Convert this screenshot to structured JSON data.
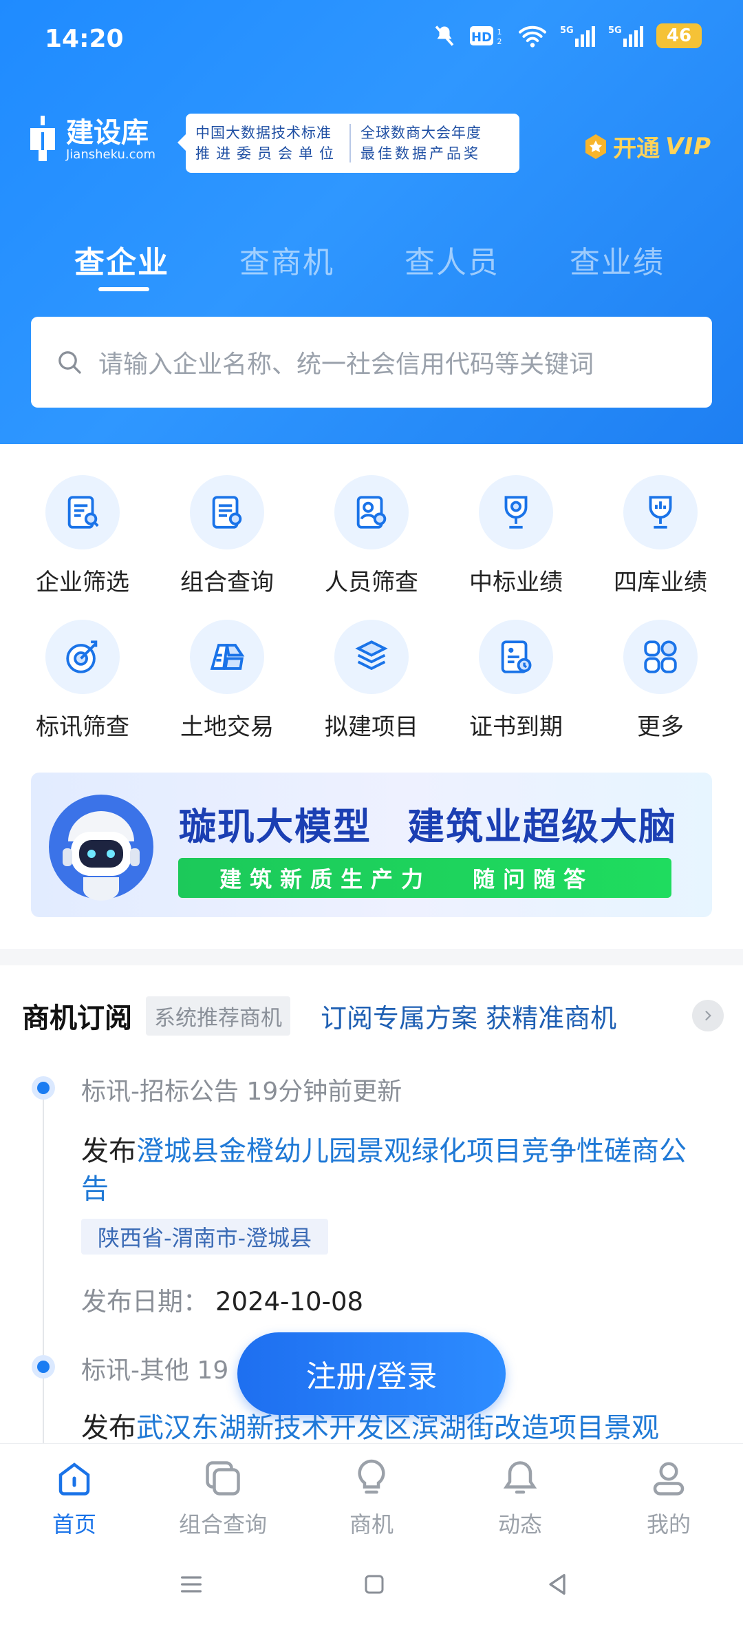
{
  "status": {
    "time": "14:20",
    "battery": "46"
  },
  "brand": {
    "name_cn": "建设库",
    "name_en": "Jiansheku.com"
  },
  "award": {
    "left_line1": "中国大数据技术标准",
    "left_line2": "推进委员会单位",
    "right_line1": "全球数商大会年度",
    "right_line2": "最佳数据产品奖"
  },
  "vip": {
    "label": "开通",
    "tag": "VIP"
  },
  "tabs": [
    "查企业",
    "查商机",
    "查人员",
    "查业绩"
  ],
  "search": {
    "placeholder": "请输入企业名称、统一社会信用代码等关键词"
  },
  "grid": [
    {
      "label": "企业筛选",
      "icon": "company-filter-icon"
    },
    {
      "label": "组合查询",
      "icon": "combined-query-icon"
    },
    {
      "label": "人员筛查",
      "icon": "personnel-check-icon"
    },
    {
      "label": "中标业绩",
      "icon": "bid-win-icon"
    },
    {
      "label": "四库业绩",
      "icon": "four-library-icon"
    },
    {
      "label": "标讯筛查",
      "icon": "bid-info-icon"
    },
    {
      "label": "土地交易",
      "icon": "land-trade-icon"
    },
    {
      "label": "拟建项目",
      "icon": "planned-project-icon"
    },
    {
      "label": "证书到期",
      "icon": "certificate-expiry-icon"
    },
    {
      "label": "更多",
      "icon": "more-icon"
    }
  ],
  "banner": {
    "title1": "璇玑大模型",
    "title2": "建筑业超级大脑",
    "bar_left": "建筑新质生产力",
    "bar_right": "随问随答"
  },
  "section": {
    "title": "商机订阅",
    "tag": "系统推荐商机",
    "subtitle": "订阅专属方案 获精准商机"
  },
  "items": [
    {
      "meta": "标讯-招标公告  19分钟前更新",
      "prefix": "发布",
      "title": "澄城县金橙幼儿园景观绿化项目竞争性磋商公告",
      "region": "陕西省-渭南市-澄城县",
      "date_label": "发布日期：",
      "date": "2024-10-08"
    },
    {
      "meta": "标讯-其他  19",
      "prefix": "发布",
      "title": "武汉东湖新技术开发区滨湖街改造项目景观"
    }
  ],
  "login_button": "注册/登录",
  "nav": [
    {
      "label": "首页",
      "icon": "home-icon",
      "active": true
    },
    {
      "label": "组合查询",
      "icon": "combined-query-nav-icon"
    },
    {
      "label": "商机",
      "icon": "opportunity-icon"
    },
    {
      "label": "动态",
      "icon": "bell-icon"
    },
    {
      "label": "我的",
      "icon": "user-icon"
    }
  ],
  "colors": {
    "primary": "#1E7FF2",
    "link": "#1F79D6",
    "green": "#1FD45C",
    "vip_gold": "#FFD35A"
  }
}
